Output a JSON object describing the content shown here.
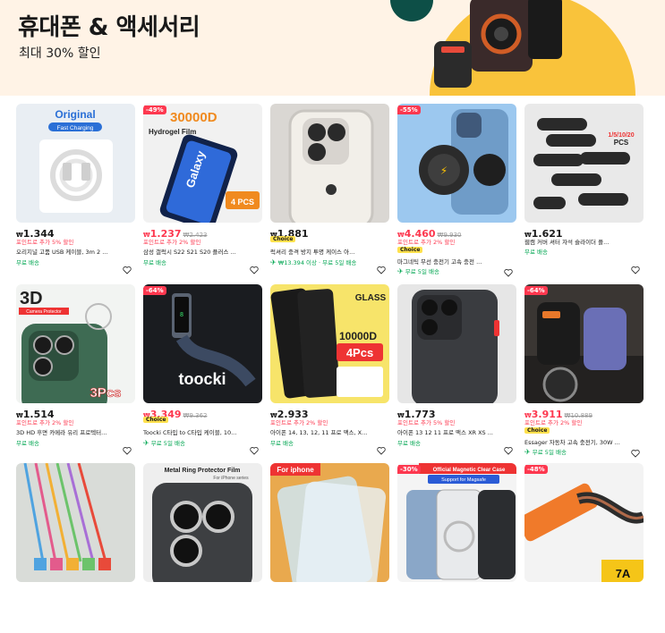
{
  "banner": {
    "title": "휴대폰 & 액세서리",
    "subtitle": "최대 30% 할인"
  },
  "products": [
    {
      "price": "1.344",
      "promo": "포인트로 추가 5% 할인",
      "title": "오리지널 고품 USB 케이블, 3m 2 ...",
      "ship": "무료 배송",
      "sale": false
    },
    {
      "discount": "-49%",
      "thumb_text": "30000D",
      "thumb_sub": "Hydrogel Film",
      "price": "1.237",
      "orig": "₩2.423",
      "promo": "포인트로 추가 2% 할인",
      "title": "삼성 갤럭시 S22 S21 S20 플러스 ...",
      "ship": "무료 배송",
      "sale": true
    },
    {
      "price": "1.881",
      "choice": "Choice",
      "title": "럭셔리 충격 방지 투명 케이스 아...",
      "ship": "₩13.394 이상 · 무료 5일 배송",
      "sale": false
    },
    {
      "discount": "-55%",
      "price": "4.460",
      "orig": "₩9.930",
      "promo": "포인트로 추가 2% 할인",
      "choice": "Choice",
      "title": "마그네틱 무선 충전기 고속 충전 ...",
      "ship": "무료 5일 배송",
      "sale": true
    },
    {
      "price": "1.621",
      "thumb_text": "1/5/10/20 PCS",
      "title": "웹캠 커버 셔터 자석 슬라이더 플...",
      "ship": "무료 배송",
      "sale": false
    },
    {
      "thumb_text": "3D",
      "thumb_sub": "Camera Protector",
      "thumb_badge": "3Pcs",
      "price": "1.514",
      "promo": "포인트로 추가 2% 할인",
      "title": "3D HD 후면 카메라 유리 프로텍터...",
      "ship": "무료 배송",
      "sale": false
    },
    {
      "discount": "-64%",
      "thumb_text": "toocki",
      "price": "3.349",
      "orig": "₩9.362",
      "choice": "Choice",
      "title": "Toocki C타입 to C타입 케이블, 10...",
      "ship": "무료 5일 배송",
      "sale": true
    },
    {
      "thumb_text": "10000D",
      "thumb_sub": "GLASS",
      "thumb_badge": "4Pcs",
      "price": "2.933",
      "promo": "포인트로 추가 2% 할인",
      "title": "아이폰 14, 13, 12, 11 프로 맥스, X...",
      "ship": "무료 배송",
      "sale": false
    },
    {
      "price": "1.773",
      "promo": "포인트로 추가 5% 할인",
      "title": "아이폰 13 12 11 프로 맥스 XR XS ...",
      "ship": "무료 배송",
      "sale": false
    },
    {
      "discount": "-64%",
      "price": "3.911",
      "orig": "₩10.889",
      "promo": "포인트로 추가 2% 할인",
      "title": "Essager 자동차 고속 충전기, 30W ...",
      "ship": "무료 5일 배송",
      "sale": true
    },
    {
      "sale": false
    },
    {
      "thumb_text": "Metal Ring Protector Film",
      "thumb_sub": "For iPhone series",
      "sale": false
    },
    {
      "thumb_text": "For iphone",
      "sale": false
    },
    {
      "discount": "-30%",
      "thumb_text": "Official Magnetic Clear Case",
      "thumb_sub": "Support for Magsafe",
      "sale": true
    },
    {
      "discount": "-48%",
      "thumb_text": "7A",
      "sale": true
    }
  ],
  "currency": "₩",
  "colors": {
    "sale": "#fd384f",
    "free_ship": "#00a651",
    "choice": "#ffe14d",
    "banner_bg": "#fff3e6"
  }
}
